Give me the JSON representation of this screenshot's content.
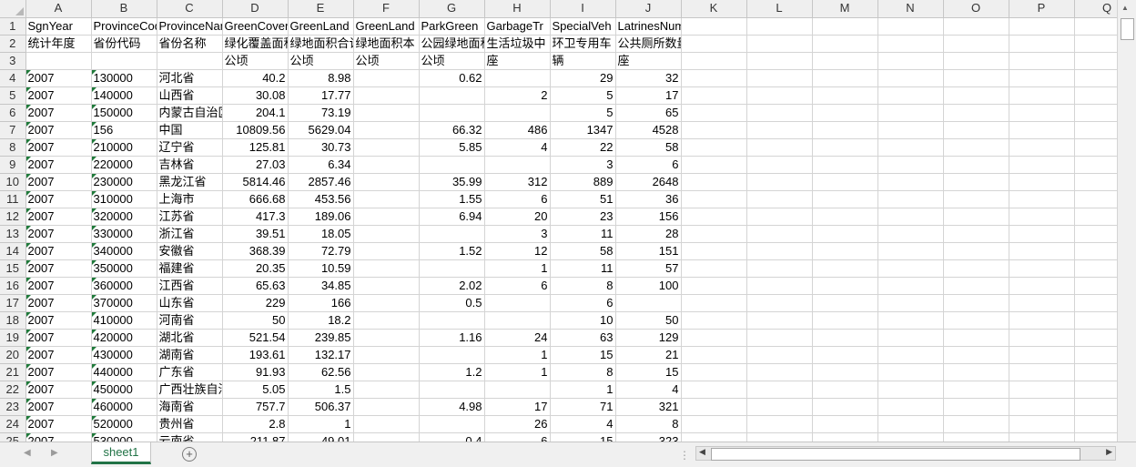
{
  "sheet": {
    "columns": [
      "A",
      "B",
      "C",
      "D",
      "E",
      "F",
      "G",
      "H",
      "I",
      "J",
      "K",
      "L",
      "M",
      "N",
      "O",
      "P",
      "Q"
    ],
    "rows": [
      [
        "SgnYear",
        "ProvinceCode",
        "ProvinceName",
        "GreenCoverage",
        "GreenLand",
        "GreenLand",
        "ParkGreen",
        "GarbageTr",
        "SpecialVeh",
        "LatrinesNum"
      ],
      [
        "统计年度",
        "省份代码",
        "省份名称",
        "绿化覆盖面积",
        "绿地面积合计",
        "绿地面积本",
        "公园绿地面积",
        "生活垃圾中",
        "环卫专用车",
        "公共厕所数量"
      ],
      [
        "",
        "",
        "",
        "公顷",
        "公顷",
        "公顷",
        "公顷",
        "座",
        "辆",
        "座"
      ],
      [
        "2007",
        "130000",
        "河北省",
        "40.2",
        "8.98",
        "",
        "0.62",
        "",
        "29",
        "32"
      ],
      [
        "2007",
        "140000",
        "山西省",
        "30.08",
        "17.77",
        "",
        "",
        "2",
        "5",
        "17"
      ],
      [
        "2007",
        "150000",
        "内蒙古自治区",
        "204.1",
        "73.19",
        "",
        "",
        "",
        "5",
        "65"
      ],
      [
        "2007",
        "156",
        "中国",
        "10809.56",
        "5629.04",
        "",
        "66.32",
        "486",
        "1347",
        "4528"
      ],
      [
        "2007",
        "210000",
        "辽宁省",
        "125.81",
        "30.73",
        "",
        "5.85",
        "4",
        "22",
        "58"
      ],
      [
        "2007",
        "220000",
        "吉林省",
        "27.03",
        "6.34",
        "",
        "",
        "",
        "3",
        "6"
      ],
      [
        "2007",
        "230000",
        "黑龙江省",
        "5814.46",
        "2857.46",
        "",
        "35.99",
        "312",
        "889",
        "2648"
      ],
      [
        "2007",
        "310000",
        "上海市",
        "666.68",
        "453.56",
        "",
        "1.55",
        "6",
        "51",
        "36"
      ],
      [
        "2007",
        "320000",
        "江苏省",
        "417.3",
        "189.06",
        "",
        "6.94",
        "20",
        "23",
        "156"
      ],
      [
        "2007",
        "330000",
        "浙江省",
        "39.51",
        "18.05",
        "",
        "",
        "3",
        "11",
        "28"
      ],
      [
        "2007",
        "340000",
        "安徽省",
        "368.39",
        "72.79",
        "",
        "1.52",
        "12",
        "58",
        "151"
      ],
      [
        "2007",
        "350000",
        "福建省",
        "20.35",
        "10.59",
        "",
        "",
        "1",
        "11",
        "57"
      ],
      [
        "2007",
        "360000",
        "江西省",
        "65.63",
        "34.85",
        "",
        "2.02",
        "6",
        "8",
        "100"
      ],
      [
        "2007",
        "370000",
        "山东省",
        "229",
        "166",
        "",
        "0.5",
        "",
        "6",
        ""
      ],
      [
        "2007",
        "410000",
        "河南省",
        "50",
        "18.2",
        "",
        "",
        "",
        "10",
        "50"
      ],
      [
        "2007",
        "420000",
        "湖北省",
        "521.54",
        "239.85",
        "",
        "1.16",
        "24",
        "63",
        "129"
      ],
      [
        "2007",
        "430000",
        "湖南省",
        "193.61",
        "132.17",
        "",
        "",
        "1",
        "15",
        "21"
      ],
      [
        "2007",
        "440000",
        "广东省",
        "91.93",
        "62.56",
        "",
        "1.2",
        "1",
        "8",
        "15"
      ],
      [
        "2007",
        "450000",
        "广西壮族自治区",
        "5.05",
        "1.5",
        "",
        "",
        "",
        "1",
        "4"
      ],
      [
        "2007",
        "460000",
        "海南省",
        "757.7",
        "506.37",
        "",
        "4.98",
        "17",
        "71",
        "321"
      ],
      [
        "2007",
        "520000",
        "贵州省",
        "2.8",
        "1",
        "",
        "",
        "26",
        "4",
        "8"
      ],
      [
        "2007",
        "530000",
        "云南省",
        "211.87",
        "49.01",
        "",
        "0.4",
        "6",
        "15",
        "323"
      ]
    ]
  },
  "tabs": {
    "sheet1": "sheet1"
  }
}
